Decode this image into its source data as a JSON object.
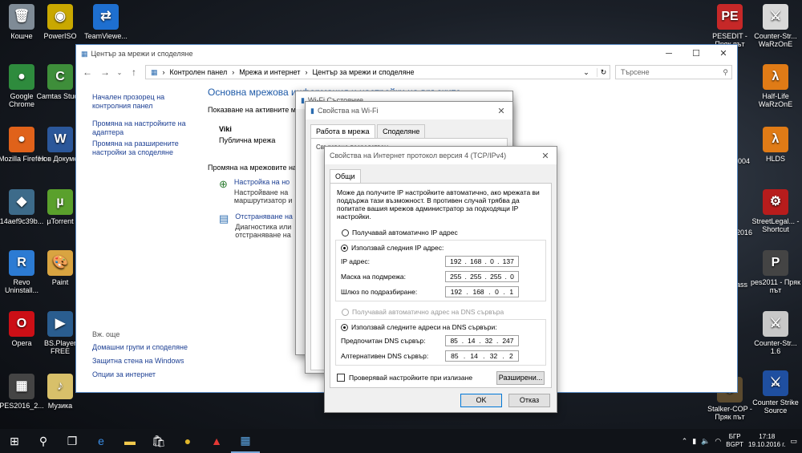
{
  "desktop_left": [
    {
      "label": "Кошче",
      "icon": "recycle-bin-icon",
      "color": "#7f8b96",
      "glyph": "🗑"
    },
    {
      "label": "PowerISO",
      "icon": "poweriso-icon",
      "color": "#c9a800",
      "glyph": "◉"
    },
    {
      "label": "TeamViewe...",
      "icon": "teamviewer-icon",
      "color": "#1e6fd0",
      "glyph": "⇄"
    },
    {
      "label": "Google Chrome",
      "icon": "chrome-icon",
      "color": "#2e8b3d",
      "glyph": "●"
    },
    {
      "label": "Camtas Studio",
      "icon": "camtasia-icon",
      "color": "#3e8e3a",
      "glyph": "C"
    },
    {
      "label": "Mozilla Firefox",
      "icon": "firefox-icon",
      "color": "#e0621a",
      "glyph": "●"
    },
    {
      "label": "Нов Докумен",
      "icon": "word-icon",
      "color": "#2b579a",
      "glyph": "W"
    },
    {
      "label": "14aef9c39b...",
      "icon": "file-icon",
      "color": "#3d6b8a",
      "glyph": "◆"
    },
    {
      "label": "µTorrent",
      "icon": "utorrent-icon",
      "color": "#5aa02c",
      "glyph": "µ"
    },
    {
      "label": "Revo Uninstall...",
      "icon": "revo-icon",
      "color": "#2c7bd3",
      "glyph": "R"
    },
    {
      "label": "Paint",
      "icon": "paint-icon",
      "color": "#d9a441",
      "glyph": "🎨"
    },
    {
      "label": "Opera",
      "icon": "opera-icon",
      "color": "#cc0f16",
      "glyph": "O"
    },
    {
      "label": "BS.Player FREE",
      "icon": "bsplayer-icon",
      "color": "#2a5d8f",
      "glyph": "▶"
    },
    {
      "label": "PES2016_2...",
      "icon": "pes-icon",
      "color": "#444",
      "glyph": "▦"
    },
    {
      "label": "Музика",
      "icon": "music-icon",
      "color": "#d8c06a",
      "glyph": "♪"
    }
  ],
  "desktop_right": [
    {
      "label": "PESEDIT - Пряк път",
      "icon": "pesedit-icon",
      "color": "#c62828",
      "glyph": "PE"
    },
    {
      "label": "Counter-Str... WaRzOnE",
      "icon": "counterstrike-icon",
      "color": "#d8d8d8",
      "glyph": "⚔"
    },
    {
      "label": "Half-Life WaRzOnE",
      "icon": "halflife-icon",
      "color": "#e07b16",
      "glyph": "λ"
    },
    {
      "label": "HLDS",
      "icon": "hlds-icon",
      "color": "#e07b16",
      "glyph": "λ"
    },
    {
      "label": "StreetLegal... - Shortcut",
      "icon": "streetlegal-icon",
      "color": "#b71c1c",
      "glyph": "⚙"
    },
    {
      "label": "pes2011 - Пряк път",
      "icon": "pes2011-icon",
      "color": "#444",
      "glyph": "P"
    },
    {
      "label": "Counter-Str... 1.6",
      "icon": "cs16-icon",
      "color": "#c8c8c8",
      "glyph": "⚔"
    },
    {
      "label": "Counter Strike Source",
      "icon": "css-icon",
      "color": "#1f4fa0",
      "glyph": "⚔"
    }
  ],
  "desktop_partial": [
    "2004",
    "2016",
    "ass",
    "Stalker-COP - Пряк път"
  ],
  "explorer": {
    "title": "Център за мрежи и споделяне",
    "min": "─",
    "max": "☐",
    "close": "✕",
    "breadcrumb": [
      "Контролен панел",
      "Мрежа и интернет",
      "Център за мрежи и споделяне"
    ],
    "search_placeholder": "Търсене",
    "left_links": [
      "Начален прозорец на контролния панел",
      "Промяна на настройките на адаптера",
      "Промяна на разширените настройки за споделяне"
    ],
    "see_also": "Вж. още",
    "see_also_links": [
      "Домашни групи и споделяне",
      "Защитна стена на Windows",
      "Опции за интернет"
    ],
    "heading": "Основна мрежова информация и настройки на връзките",
    "active_label": "Показване на активните мрежи",
    "network_name": "Viki",
    "network_type": "Публична мрежа",
    "change_label": "Промяна на мрежовите настройки",
    "link1": "Настройка на но",
    "desc1a": "Настройване на",
    "desc1b": "маршрутизатор и",
    "link2": "Отстраняване на",
    "desc2a": "Диагностика или",
    "desc2b": "отстраняване на"
  },
  "wifi_status": {
    "title": "Wi-Fi Състояние"
  },
  "wifi_props": {
    "title": "Свойства на Wi-Fi",
    "tabs": [
      "Работа в мрежа",
      "Споделяне"
    ],
    "connect_label": "Свързване посредством"
  },
  "ipv4": {
    "title": "Свойства на Интернет протокол версия 4 (TCP/IPv4)",
    "tab": "Общи",
    "intro": "Може да получите IP настройките автоматично, ако мрежата ви поддържа тази възможност. В противен случай трябва да попитате вашия мрежов администратор за подходящи IP настройки.",
    "auto_ip": "Получавай автоматично IP адрес",
    "use_ip": "Използвай следния IP адрес:",
    "ip_label": "IP адрес:",
    "ip": [
      "192",
      "168",
      "0",
      "137"
    ],
    "mask_label": "Маска на подмрежа:",
    "mask": [
      "255",
      "255",
      "255",
      "0"
    ],
    "gw_label": "Шлюз по подразбиране:",
    "gw": [
      "192",
      "168",
      "0",
      "1"
    ],
    "auto_dns": "Получавай автоматично адрес на DNS сървъра",
    "use_dns": "Използвай следните адреси на DNS сървъри:",
    "pref_label": "Предпочитан DNS сървър:",
    "pref": [
      "85",
      "14",
      "32",
      "247"
    ],
    "alt_label": "Алтернативен DNS сървър:",
    "alt": [
      "85",
      "14",
      "32",
      "2"
    ],
    "validate": "Проверявай настройките при излизане",
    "advanced": "Разширени...",
    "ok": "OK",
    "cancel": "Отказ"
  },
  "taskbar": {
    "lang1": "БГР",
    "lang2": "BGPT",
    "time": "17:18",
    "date": "19.10.2016 г."
  }
}
